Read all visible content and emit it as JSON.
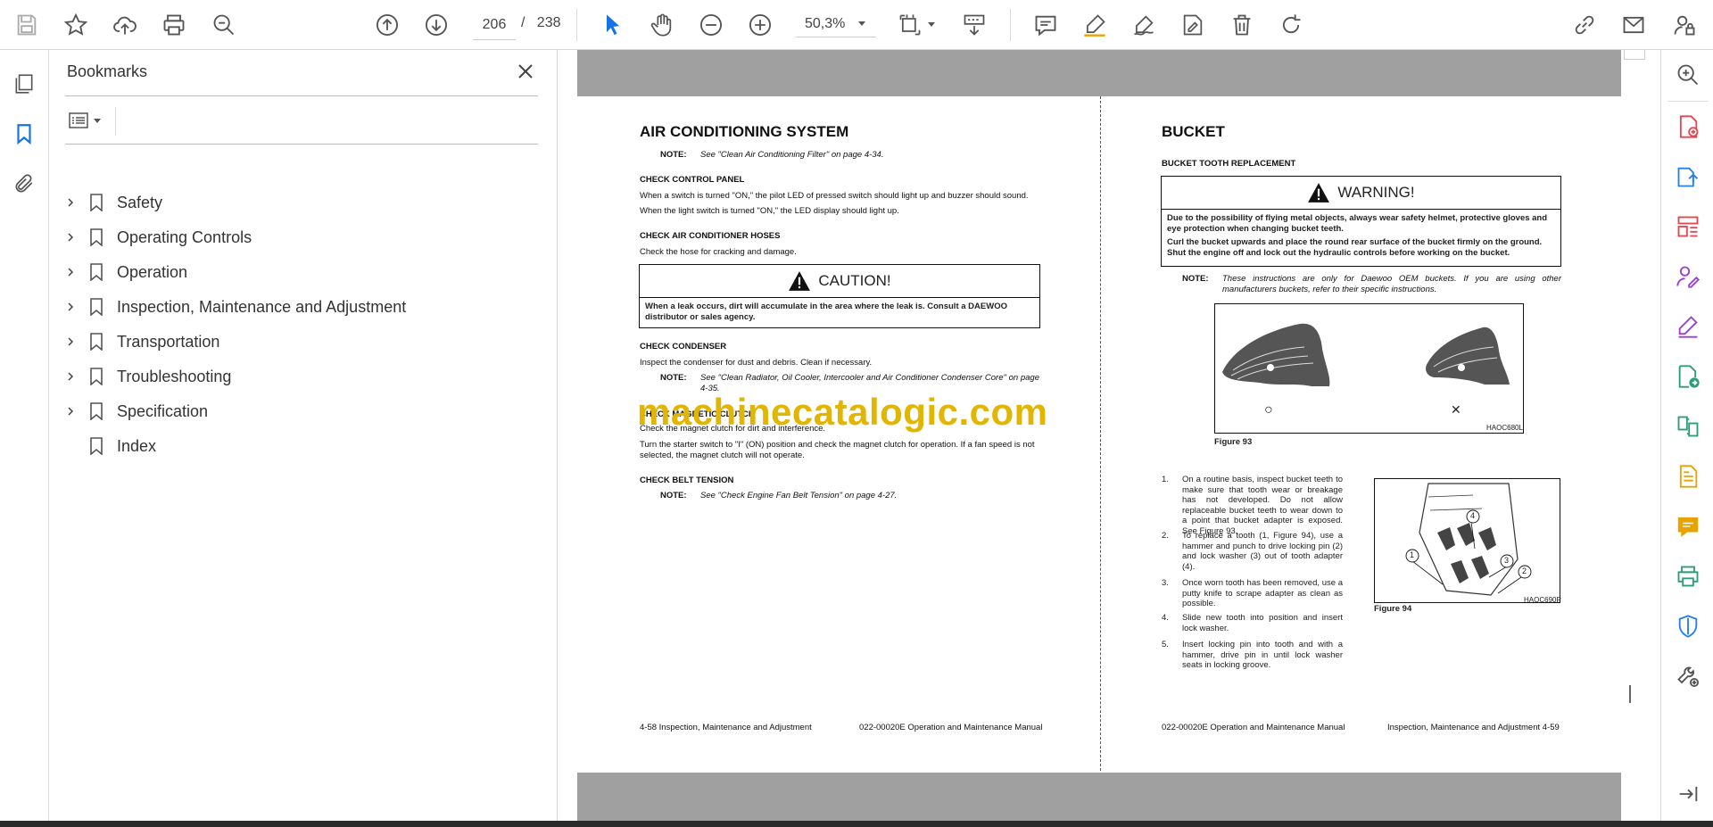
{
  "toolbar": {
    "current_page": "206",
    "page_separator": "/",
    "total_pages": "238",
    "zoom": "50,3%"
  },
  "bookmarks_panel": {
    "title": "Bookmarks",
    "items": [
      {
        "label": "Safety",
        "expandable": true
      },
      {
        "label": "Operating Controls",
        "expandable": true
      },
      {
        "label": "Operation",
        "expandable": true
      },
      {
        "label": "Inspection, Maintenance and Adjustment",
        "expandable": true
      },
      {
        "label": "Transportation",
        "expandable": true
      },
      {
        "label": "Troubleshooting",
        "expandable": true
      },
      {
        "label": "Specification",
        "expandable": true
      },
      {
        "label": "Index",
        "expandable": false
      }
    ]
  },
  "left_page": {
    "title": "AIR CONDITIONING SYSTEM",
    "note1_label": "NOTE:",
    "note1_text": "See \"Clean Air Conditioning Filter\" on page 4-34.",
    "sec1_heading": "CHECK CONTROL PANEL",
    "sec1_line1": "When a switch is turned \"ON,\" the pilot LED of pressed switch should light up and buzzer should sound.",
    "sec1_line2": "When the light switch is turned \"ON,\" the LED display should light up.",
    "sec2_heading": "CHECK AIR CONDITIONER HOSES",
    "sec2_line1": "Check the hose for cracking and damage.",
    "caution_title": "CAUTION!",
    "caution_text": "When a leak occurs, dirt will accumulate in the area where the leak is. Consult a DAEWOO distributor or sales agency.",
    "sec3_heading": "CHECK CONDENSER",
    "sec3_line1": "Inspect the condenser for dust and debris. Clean if necessary.",
    "note2_label": "NOTE:",
    "note2_text": "See \"Clean Radiator, Oil Cooler, Intercooler and Air Conditioner Condenser Core\" on page 4-35.",
    "sec4_heading": "CHECK MAGNETIC CLUTCH",
    "sec4_line1": "Check the magnet clutch for dirt and interference.",
    "sec4_line2": "Turn the starter switch to \"I\" (ON) position and check the magnet clutch for operation. If a fan speed is not selected, the magnet clutch will not operate.",
    "sec5_heading": "CHECK BELT TENSION",
    "note3_label": "NOTE:",
    "note3_text": "See \"Check Engine Fan Belt Tension\" on page 4-27.",
    "footer_left": "4-58  Inspection, Maintenance and Adjustment",
    "footer_right": "022-00020E Operation and Maintenance Manual"
  },
  "watermark": "machinecatalogic.com",
  "right_page": {
    "title": "BUCKET",
    "subheading": "BUCKET TOOTH REPLACEMENT",
    "warning_title": "WARNING!",
    "warning_text1": "Due to the possibility of flying metal objects, always wear safety helmet, protective gloves and eye protection when changing bucket teeth.",
    "warning_text2": "Curl the bucket upwards and place the round rear surface of the bucket firmly on the ground. Shut the engine off and lock out the hydraulic controls before working on the bucket.",
    "note_label": "NOTE:",
    "note_text": "These instructions are only for Daewoo OEM buckets. If you are using other manufacturers buckets, refer to their specific instructions.",
    "fig93_caption": "Figure 93",
    "fig93_id": "HAOC680L",
    "fig93_mark_ok": "○",
    "fig93_mark_bad": "✕",
    "fig94_caption": "Figure 94",
    "fig94_id": "HAOC690P",
    "fig94_labels": [
      "1",
      "2",
      "3",
      "4"
    ],
    "steps": [
      {
        "num": "1.",
        "text": "On a routine basis, inspect bucket teeth to make sure that tooth wear or breakage has not developed. Do not allow replaceable bucket teeth to wear down to a point that bucket adapter is exposed. See Figure 93."
      },
      {
        "num": "2.",
        "text": "To replace a tooth (1, Figure 94), use a hammer and punch to drive locking pin (2) and lock washer (3) out of tooth adapter (4)."
      },
      {
        "num": "3.",
        "text": "Once worn tooth has been removed, use a putty knife to scrape adapter as clean as possible."
      },
      {
        "num": "4.",
        "text": "Slide new tooth into position and insert lock washer."
      },
      {
        "num": "5.",
        "text": "Insert locking pin into tooth and with a hammer, drive pin in until lock washer seats in locking groove."
      }
    ],
    "footer_left": "022-00020E Operation and Maintenance Manual",
    "footer_right": "Inspection, Maintenance and Adjustment 4-59"
  },
  "colors": {
    "accent_blue": "#1473e6",
    "tool_red": "#e34850",
    "tool_purple": "#9b3fd6",
    "tool_green": "#2d9d78",
    "tool_yellow": "#e8a300",
    "tool_blue": "#2680eb",
    "watermark": "#e2b500"
  }
}
